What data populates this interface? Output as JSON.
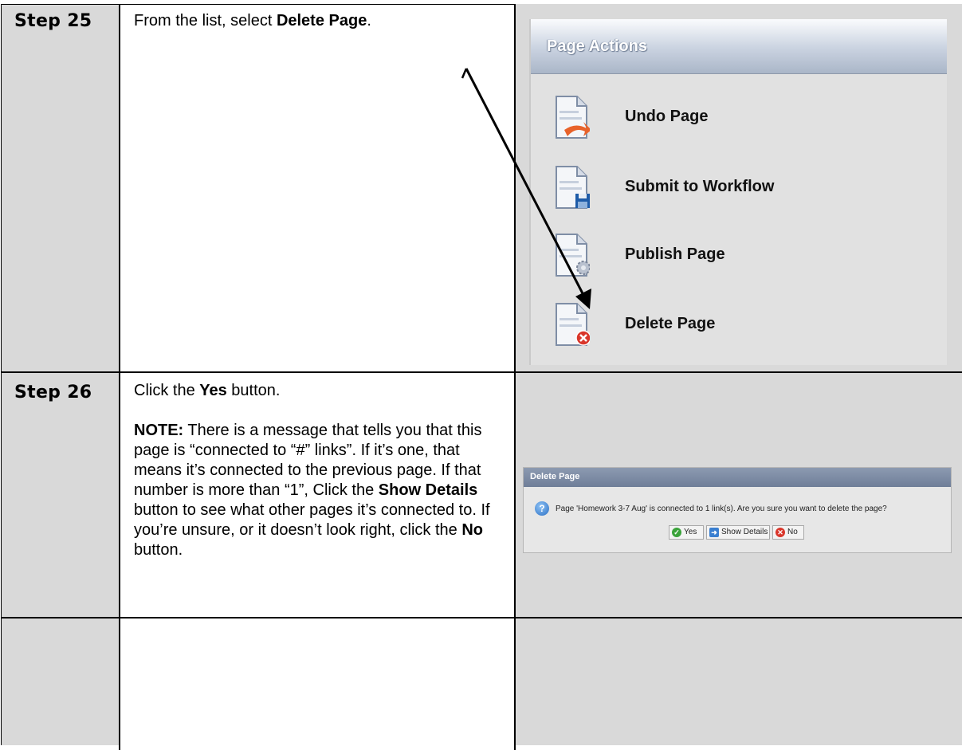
{
  "steps": [
    {
      "label": "Step 25",
      "text_parts": [
        "From the list, select ",
        "Delete Page",
        "."
      ]
    },
    {
      "label": "Step 26",
      "intro_parts": [
        "Click the ",
        "Yes",
        " button."
      ],
      "note": {
        "lead": "NOTE:",
        "t1": "  There is a message that tells you that this page is “connected to “#” links”.  If it’s one, that means it’s connected to the previous page.  If that number is more than “1”, Click the ",
        "show_details": "Show Details",
        "t2": " button to see what other pages it’s connected to.  If you’re unsure, or it doesn’t look right, click the ",
        "no": "No",
        "t3": " button."
      }
    }
  ],
  "page_actions": {
    "title": "Page Actions",
    "items": [
      {
        "label": "Undo Page",
        "badge_icon": "undo-arrow-icon"
      },
      {
        "label": "Submit to Workflow",
        "badge_icon": "save-disk-icon"
      },
      {
        "label": "Publish Page",
        "badge_icon": "gear-icon"
      },
      {
        "label": "Delete Page",
        "badge_icon": "delete-x-icon"
      }
    ]
  },
  "dialog": {
    "title": "Delete Page",
    "message": "Page 'Homework 3-7 Aug' is connected to 1 link(s). Are you sure you want to delete the page?",
    "buttons": {
      "yes": "Yes",
      "show_details": "Show Details",
      "no": "No"
    }
  },
  "colors": {
    "row_gray": "#d9d9d9",
    "accent_orange": "#e8622a",
    "accent_red": "#d9362b",
    "dialog_bar": "#7d8ba4"
  }
}
